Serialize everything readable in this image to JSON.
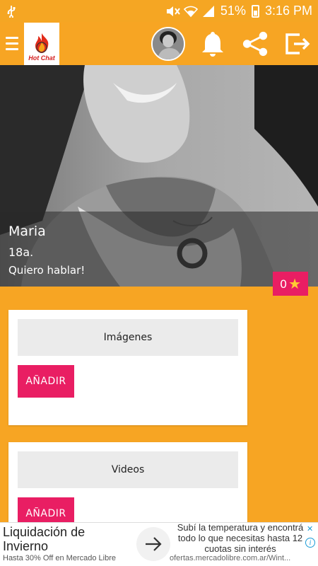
{
  "status_bar": {
    "battery": "51%",
    "time": "3:16 PM"
  },
  "app_bar": {
    "logo_text": "Hot Chat"
  },
  "profile": {
    "name": "Maria",
    "age": "18a.",
    "status": "Quiero hablar!",
    "rating": "0"
  },
  "sections": [
    {
      "title": "Imágenes",
      "button": "AÑADIR"
    },
    {
      "title": "Videos",
      "button": "AÑADIR"
    }
  ],
  "ad": {
    "title": "Liquidación de Invierno",
    "subtitle": "Hasta 30% Off en Mercado Libre",
    "description": "Subí la temperatura y encontrá todo lo que necesitas hasta 12 cuotas sin interés",
    "url": "ofertas.mercadolibre.com.ar/Wint..."
  },
  "colors": {
    "primary": "#f7a523",
    "accent": "#e91e63",
    "star": "#ffcc33"
  }
}
